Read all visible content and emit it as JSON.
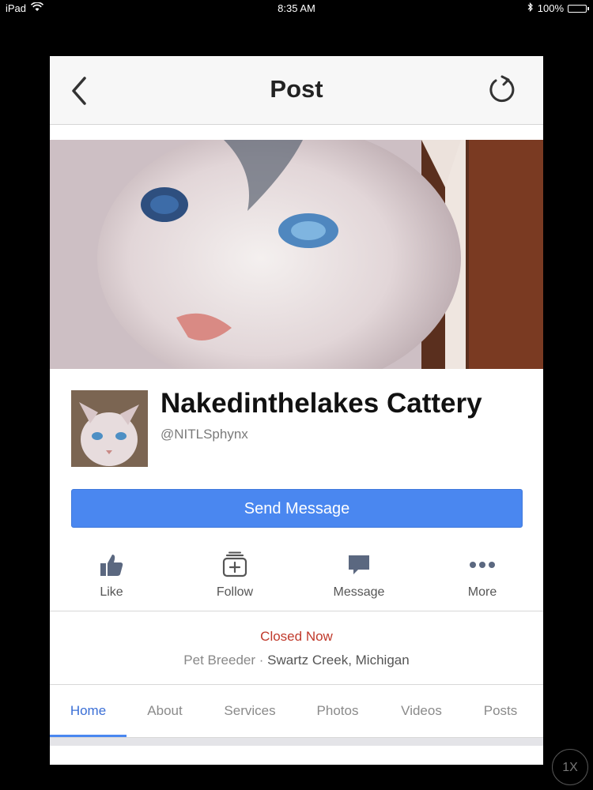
{
  "status_bar": {
    "device": "iPad",
    "time": "8:35 AM",
    "battery": "100%"
  },
  "navbar": {
    "title": "Post",
    "back_icon": "chevron-left-icon",
    "refresh_icon": "refresh-icon"
  },
  "profile": {
    "name": "Nakedinthelakes Cattery",
    "handle": "@NITLSphynx",
    "send_message_label": "Send Message"
  },
  "actions": [
    {
      "label": "Like",
      "icon": "thumbs-up-icon"
    },
    {
      "label": "Follow",
      "icon": "follow-plus-icon"
    },
    {
      "label": "Message",
      "icon": "speech-bubble-icon"
    },
    {
      "label": "More",
      "icon": "more-dots-icon"
    }
  ],
  "info": {
    "status": "Closed Now",
    "category": "Pet Breeder",
    "separator": "·",
    "location": "Swartz Creek, Michigan"
  },
  "tabs": [
    {
      "label": "Home",
      "active": true
    },
    {
      "label": "About"
    },
    {
      "label": "Services"
    },
    {
      "label": "Photos"
    },
    {
      "label": "Videos"
    },
    {
      "label": "Posts"
    }
  ],
  "zoom": {
    "label": "1X"
  },
  "colors": {
    "accent": "#4a87f0",
    "closed": "#c0392b"
  }
}
